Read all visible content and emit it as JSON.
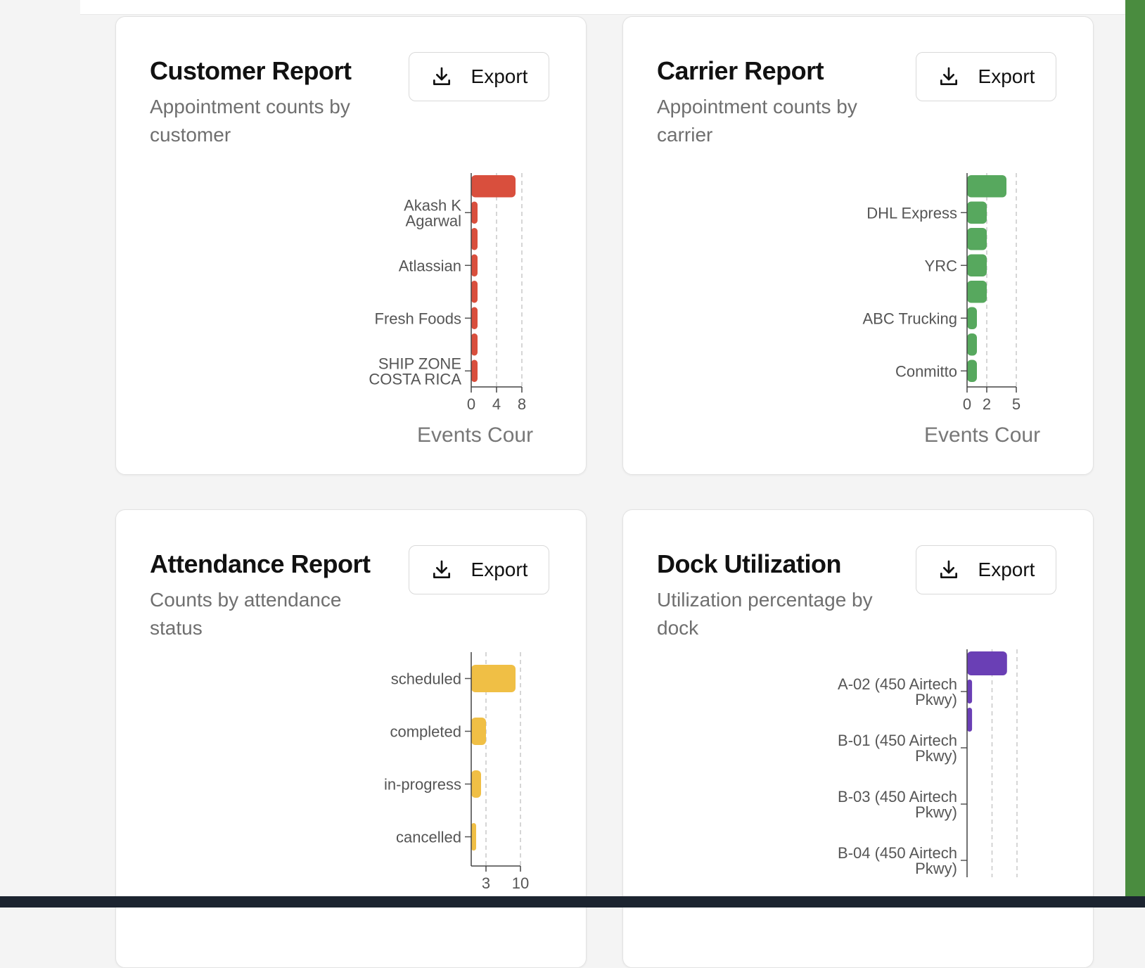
{
  "cards": [
    {
      "title": "Customer Report",
      "subtitle": "Appointment counts by customer",
      "export_label": "Export",
      "export_icon": "download-icon"
    },
    {
      "title": "Carrier Report",
      "subtitle": "Appointment counts by carrier",
      "export_label": "Export",
      "export_icon": "download-icon"
    },
    {
      "title": "Attendance Report",
      "subtitle": "Counts by attendance status",
      "export_label": "Export",
      "export_icon": "download-icon"
    },
    {
      "title": "Dock Utilization",
      "subtitle": "Utilization percentage by dock",
      "export_label": "Export",
      "export_icon": "download-icon"
    }
  ],
  "chart_data": [
    {
      "type": "bar",
      "orientation": "horizontal",
      "color": "#d94f3d",
      "categories": [
        "",
        "Akash K Agarwal",
        "",
        "Atlassian",
        "",
        "Fresh Foods",
        "",
        "SHIP ZONE COSTA RICA"
      ],
      "values": [
        7,
        1,
        1,
        1,
        1,
        1,
        1,
        1
      ],
      "xticks": [
        0,
        4,
        8
      ],
      "xlim": [
        0,
        8
      ],
      "xlabel": "Events Cour",
      "grid": "vertical dashed"
    },
    {
      "type": "bar",
      "orientation": "horizontal",
      "color": "#57a85e",
      "categories": [
        "",
        "DHL Express",
        "",
        "YRC",
        "",
        "ABC Trucking",
        "",
        "Conmitto"
      ],
      "values": [
        4,
        2,
        2,
        2,
        2,
        1,
        1,
        1
      ],
      "xticks": [
        0,
        2,
        5
      ],
      "xlim": [
        0,
        5
      ],
      "xlabel": "Events Cour",
      "grid": "vertical dashed"
    },
    {
      "type": "bar",
      "orientation": "horizontal",
      "color": "#f0bf45",
      "categories": [
        "scheduled",
        "completed",
        "in-progress",
        "cancelled"
      ],
      "values": [
        9,
        3,
        2,
        1
      ],
      "xticks": [
        3,
        10
      ],
      "xlim": [
        0,
        10
      ],
      "xlabel": "",
      "grid": "vertical dashed"
    },
    {
      "type": "bar",
      "orientation": "horizontal",
      "color": "#6a3fb5",
      "categories": [
        "",
        "A-02 (450 Airtech Pkwy)",
        "",
        "B-01 (450 Airtech Pkwy)",
        "",
        "B-03 (450 Airtech Pkwy)",
        "",
        "B-04 (450 Airtech Pkwy)"
      ],
      "values": [
        40,
        5,
        5,
        0,
        0,
        0,
        0,
        0
      ],
      "xlim": [
        0,
        50
      ],
      "xlabel": "",
      "grid": "vertical dashed"
    }
  ]
}
